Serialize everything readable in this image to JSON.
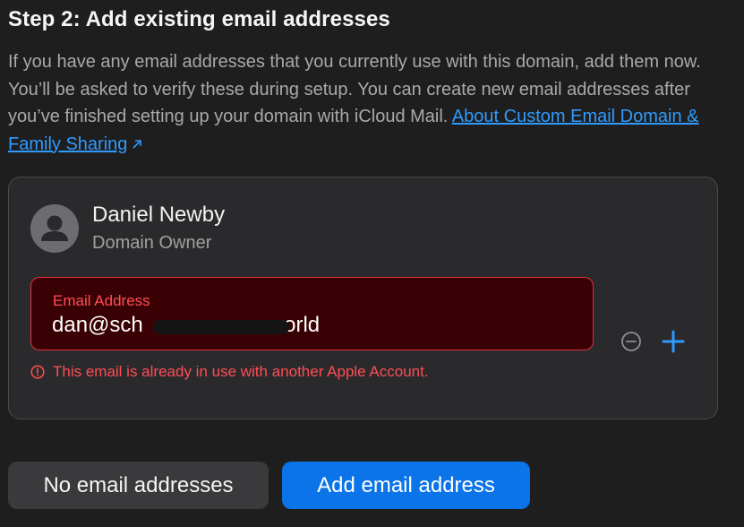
{
  "step": {
    "title": "Step 2: Add existing email addresses",
    "description": "If you have any email addresses that you currently use with this domain, add them now. You’ll be asked to verify these during setup. You can create new email addresses after you’ve finished setting up your domain with iCloud Mail.",
    "link_text": "About Custom Email Domain & Family Sharing",
    "link_icon": "external-arrow-icon"
  },
  "owner": {
    "name": "Daniel Newby",
    "role": "Domain Owner",
    "avatar_icon": "person-icon"
  },
  "email_field": {
    "label": "Email Address",
    "value": "dan@sch                    .world",
    "error": "This email is already in use with another Apple Account.",
    "error_icon": "warning-circle-icon"
  },
  "row_actions": {
    "remove_icon": "minus-circle-icon",
    "add_icon": "plus-icon"
  },
  "buttons": {
    "no_email": "No email addresses",
    "add_email": "Add email address"
  },
  "colors": {
    "accent": "#0a74e8",
    "link": "#2f9bff",
    "error": "#ff4d55",
    "error_bg": "#3a0104"
  }
}
